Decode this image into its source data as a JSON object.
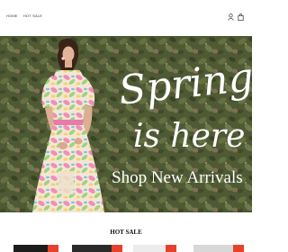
{
  "header": {
    "nav": [
      {
        "label": "HOME"
      },
      {
        "label": "Hot Sale"
      }
    ],
    "icons": [
      "user-icon",
      "shopping-bag-icon"
    ]
  },
  "hero": {
    "headline_line1": "Spring",
    "headline_line2": "is here",
    "cta_label": "Shop New Arrivals"
  },
  "section": {
    "title": "HOT SALE"
  },
  "colors": {
    "badge": "#e8412b",
    "hero_background": "#4f5a32",
    "text_light": "#ffffff"
  }
}
